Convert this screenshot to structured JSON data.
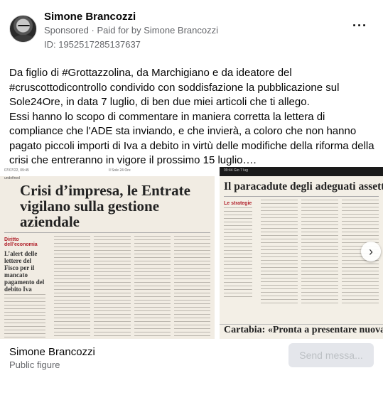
{
  "post": {
    "author": "Simone Brancozzi",
    "sponsored": "Sponsored",
    "paid_for": "Paid for by Simone Brancozzi",
    "id": "ID: 1952517285137637",
    "more_label": "···",
    "paragraph1": "Da figlio di #Grottazzolina, da Marchigiano e da ideatore del #cruscottodicontrollo condivido con soddisfazione la pubblicazione sul Sole24Ore, in data 7 luglio, di ben due miei articoli che ti allego.",
    "paragraph2": "Essi hanno lo scopo di commentare in maniera corretta la lettera di compliance che l'ADE sta inviando, e che invierà, a coloro che non hanno pagato piccoli importi di Iva a debito in virtù delle modifiche della riforma della crisi che entreranno in vigore il prossimo 15 luglio…."
  },
  "images": [
    {
      "topbar_left": "07/07/22, 09:45",
      "topbar_center": "Il Sole 24 Ore",
      "tag": "undefined",
      "headline": "Crisi d’impresa, le Entrate vigilano sulla gestione aziendale",
      "side_head": "Diritto dell’economia",
      "side_title": "L’alert delle lettere del Fisco per il mancato pagamento del debito Iva"
    },
    {
      "topbar_left": "09:44 Gio 7 lug",
      "headline": "Il paracadute degli adeguati assetti",
      "side_head": "Le strategie",
      "banner": "Cartabia: «Pronta a presentare nuova ba"
    }
  ],
  "carousel": {
    "next_icon": "›"
  },
  "footer": {
    "name": "Simone Brancozzi",
    "subtitle": "Public figure",
    "send_label": "Send messa..."
  }
}
